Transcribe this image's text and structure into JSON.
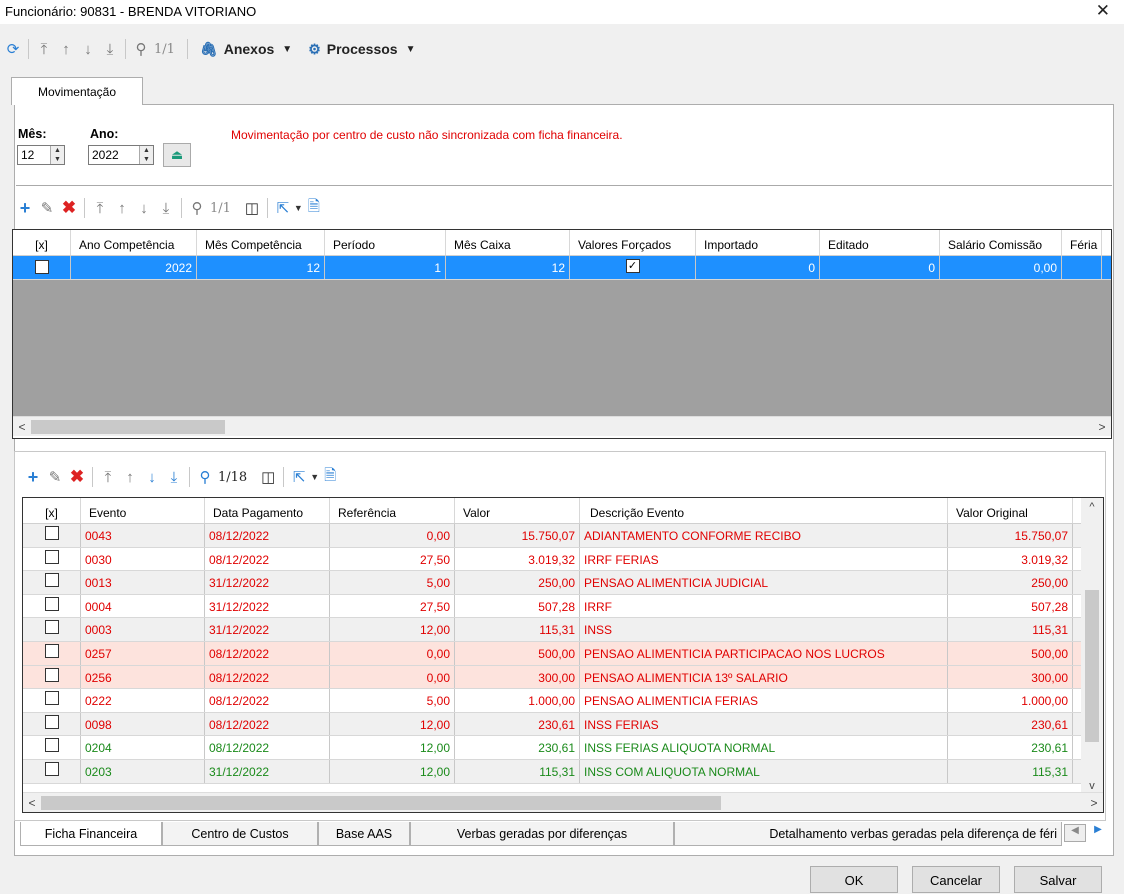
{
  "window": {
    "title": "Funcionário: 90831 - BRENDA VITORIANO",
    "close": "✕"
  },
  "toolbar": {
    "page": "1/1",
    "anexos": "Anexos",
    "processos": "Processos"
  },
  "tab_main": "Movimentação",
  "filters": {
    "mes_label": "Mês:",
    "mes_value": "12",
    "ano_label": "Ano:",
    "ano_value": "2022",
    "warning": "Movimentação por centro de custo não sincronizada com ficha financeira."
  },
  "grid1": {
    "page": "1/1",
    "headers": [
      "[x]",
      "Ano Competência",
      "Mês Competência",
      "Período",
      "Mês Caixa",
      "Valores Forçados",
      "Importado",
      "Editado",
      "Salário Comissão",
      "Féria"
    ],
    "rows": [
      {
        "ano": "2022",
        "mes": "12",
        "periodo": "1",
        "mes_caixa": "12",
        "importado": "0",
        "editado": "0",
        "salario": "0,00"
      }
    ]
  },
  "grid2": {
    "page": "1/18",
    "headers": [
      "[x]",
      "Evento",
      "Data Pagamento",
      "Referência",
      "Valor",
      "Descrição Evento",
      "Valor Original"
    ],
    "rows": [
      {
        "evento": "0043",
        "data": "08/12/2022",
        "ref": "0,00",
        "valor": "15.750,07",
        "desc": "ADIANTAMENTO CONFORME RECIBO",
        "orig": "15.750,07",
        "color": "#e00000",
        "bg": "#f0f0f0"
      },
      {
        "evento": "0030",
        "data": "08/12/2022",
        "ref": "27,50",
        "valor": "3.019,32",
        "desc": "IRRF FERIAS",
        "orig": "3.019,32",
        "color": "#e00000",
        "bg": "#ffffff"
      },
      {
        "evento": "0013",
        "data": "31/12/2022",
        "ref": "5,00",
        "valor": "250,00",
        "desc": "PENSAO ALIMENTICIA JUDICIAL",
        "orig": "250,00",
        "color": "#e00000",
        "bg": "#f0f0f0"
      },
      {
        "evento": "0004",
        "data": "31/12/2022",
        "ref": "27,50",
        "valor": "507,28",
        "desc": "IRRF",
        "orig": "507,28",
        "color": "#e00000",
        "bg": "#ffffff"
      },
      {
        "evento": "0003",
        "data": "31/12/2022",
        "ref": "12,00",
        "valor": "115,31",
        "desc": "INSS",
        "orig": "115,31",
        "color": "#e00000",
        "bg": "#f0f0f0"
      },
      {
        "evento": "0257",
        "data": "08/12/2022",
        "ref": "0,00",
        "valor": "500,00",
        "desc": "PENSAO ALIMENTICIA PARTICIPACAO NOS LUCROS",
        "orig": "500,00",
        "color": "#e00000",
        "bg": "#fde3dd"
      },
      {
        "evento": "0256",
        "data": "08/12/2022",
        "ref": "0,00",
        "valor": "300,00",
        "desc": "PENSAO ALIMENTICIA 13º SALARIO",
        "orig": "300,00",
        "color": "#e00000",
        "bg": "#fde3dd"
      },
      {
        "evento": "0222",
        "data": "08/12/2022",
        "ref": "5,00",
        "valor": "1.000,00",
        "desc": "PENSAO ALIMENTICIA  FERIAS",
        "orig": "1.000,00",
        "color": "#e00000",
        "bg": "#ffffff"
      },
      {
        "evento": "0098",
        "data": "08/12/2022",
        "ref": "12,00",
        "valor": "230,61",
        "desc": "INSS FERIAS",
        "orig": "230,61",
        "color": "#e00000",
        "bg": "#f0f0f0"
      },
      {
        "evento": "0204",
        "data": "08/12/2022",
        "ref": "12,00",
        "valor": "230,61",
        "desc": "INSS FERIAS ALIQUOTA NORMAL",
        "orig": "230,61",
        "color": "#1a8a1a",
        "bg": "#ffffff"
      },
      {
        "evento": "0203",
        "data": "31/12/2022",
        "ref": "12,00",
        "valor": "115,31",
        "desc": "INSS COM ALIQUOTA NORMAL",
        "orig": "115,31",
        "color": "#1a8a1a",
        "bg": "#f0f0f0"
      }
    ]
  },
  "bottom_tabs": [
    "Ficha Financeira",
    "Centro de Custos",
    "Base AAS",
    "Verbas geradas por diferenças",
    "Detalhamento verbas geradas pela diferença de féri"
  ],
  "buttons": {
    "ok": "OK",
    "cancel": "Cancelar",
    "save": "Salvar"
  }
}
